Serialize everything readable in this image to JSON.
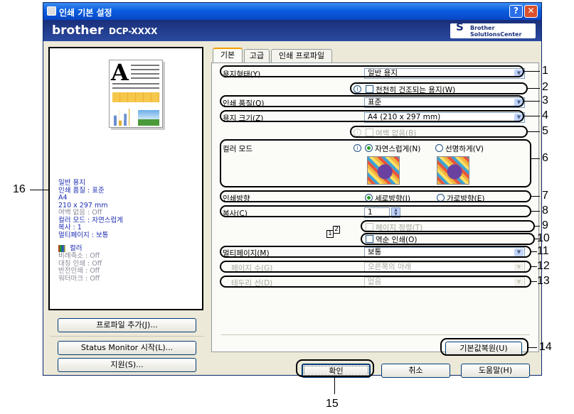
{
  "window": {
    "title": "인쇄 기본 설정",
    "help_btn": "?",
    "close_btn": "✕"
  },
  "brand": {
    "logo": "brother",
    "model": "DCP-XXXX",
    "center_line1": "Brother",
    "center_line2": "SolutionsCenter"
  },
  "preview": {
    "info_lines": [
      "일반 용지",
      "인쇄 품질 : 표준",
      "A4",
      "210 x 297 mm",
      "여백 없음 : Off",
      "컬러 모드 : 자연스럽게",
      "복사 : 1",
      "멀티페이지 : 보통"
    ],
    "color_label": "컬러",
    "extra_lines": [
      "비례축소 : Off",
      "대칭 인쇄 : Off",
      "반전인쇄 : Off",
      "워터마크 : Off"
    ]
  },
  "left_buttons": {
    "add_profile": "프로파일 추가(J)...",
    "status_monitor": "Status Monitor 시작(L)...",
    "support": "지원(S)..."
  },
  "tabs": [
    "기본",
    "고급",
    "인쇄 프로파일"
  ],
  "form": {
    "media_type_label": "용지형태(Y)",
    "media_type_value": "일반 용지",
    "slow_dry_label": "천천히 건조되는 용지(W)",
    "quality_label": "인쇄 품질(Q)",
    "quality_value": "표준",
    "paper_size_label": "용지 크기(Z)",
    "paper_size_value": "A4 (210 x 297 mm)",
    "borderless_label": "여백 없음(B)",
    "color_mode_label": "컬러 모드",
    "color_natural": "자연스럽게(N)",
    "color_vivid": "선명하게(V)",
    "orientation_label": "인쇄방향",
    "portrait": "세로방향(I)",
    "landscape": "가로방향(E)",
    "copies_label": "복사(C)",
    "copies_value": "1",
    "collate_label": "페이지 정렬(T)",
    "reverse_label": "역순 인쇄(O)",
    "multipage_label": "멀티페이지(M)",
    "multipage_value": "보통",
    "pages_label": "페이지 수(G)",
    "pages_value": "오른쪽의 아래",
    "border_label": "테두리 선(D)",
    "border_value": "없음",
    "page_badge_1": "1",
    "page_badge_2": "2"
  },
  "buttons": {
    "default": "기본값복원(U)",
    "ok": "확인",
    "cancel": "취소",
    "help": "도움말(H)"
  },
  "callouts": [
    "1",
    "2",
    "3",
    "4",
    "5",
    "6",
    "7",
    "8",
    "9",
    "10",
    "11",
    "12",
    "13",
    "14",
    "15",
    "16"
  ]
}
